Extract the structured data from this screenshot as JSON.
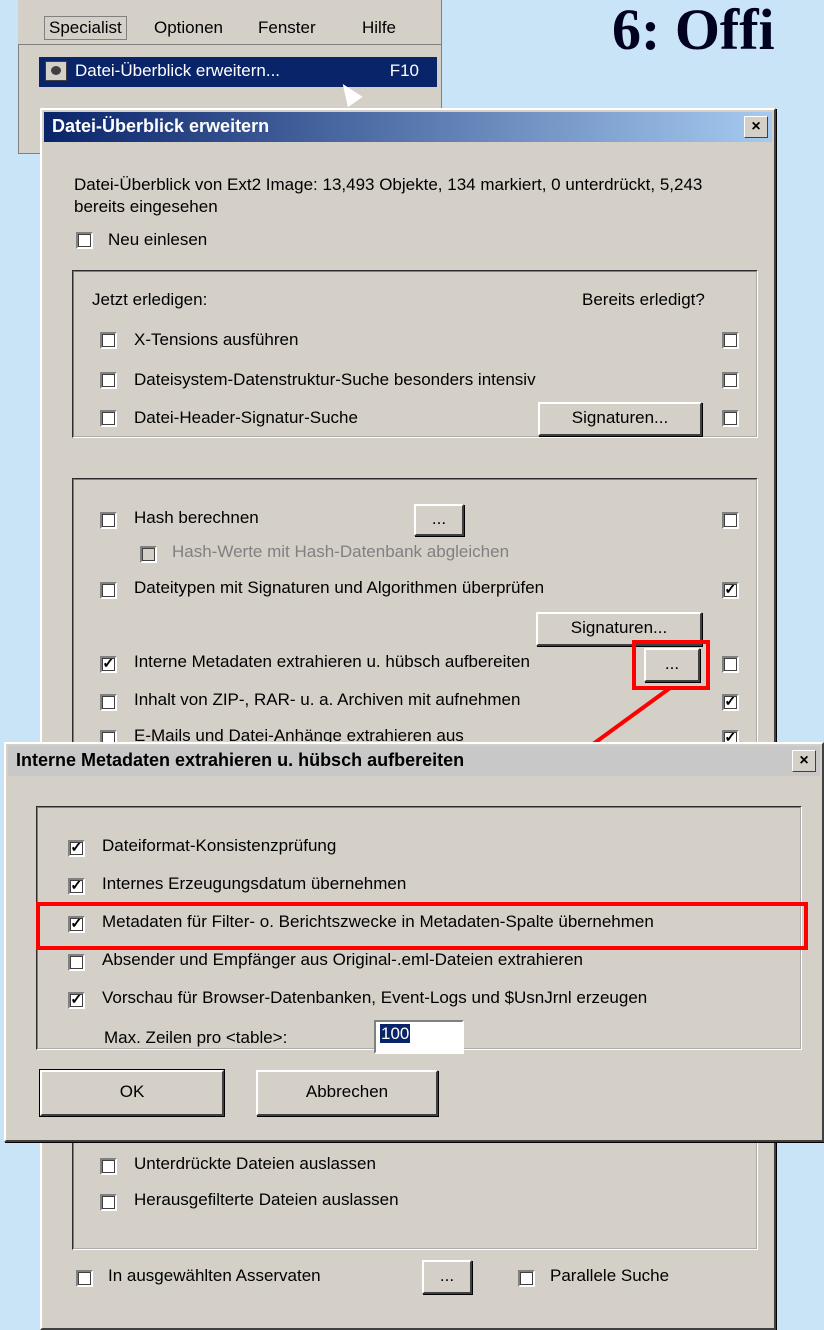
{
  "slide": {
    "title": "6: Offi"
  },
  "menu": {
    "items": [
      "Specialist",
      "Optionen",
      "Fenster",
      "Hilfe"
    ],
    "highlighted_item": "Datei-Überblick erweitern...",
    "highlighted_shortcut": "F10",
    "partial_item": "Parallele Suche",
    "partial_shortcut": "F10"
  },
  "main_dialog": {
    "title": "Datei-Überblick erweitern",
    "close": "×",
    "summary": "Datei-Überblick von Ext2 Image: 13,493 Objekte, 134 markiert, 0 unterdrückt, 5,243 bereits eingesehen",
    "reread": {
      "label": "Neu einlesen",
      "checked": false
    },
    "group1": {
      "header_left": "Jetzt erledigen:",
      "header_right": "Bereits erledigt?",
      "items": [
        {
          "label": "X-Tensions ausführen",
          "checked": false,
          "done": false
        },
        {
          "label": "Dateisystem-Datenstruktur-Suche besonders intensiv",
          "checked": false,
          "done": false
        },
        {
          "label": "Datei-Header-Signatur-Suche",
          "checked": false,
          "done": false
        }
      ],
      "signatures_button": "Signaturen..."
    },
    "group2": {
      "hash": {
        "label": "Hash berechnen",
        "checked": false,
        "done": false,
        "button": "..."
      },
      "hash_db": {
        "label": "Hash-Werte mit Hash-Datenbank abgleichen",
        "checked": false
      },
      "filetypes": {
        "label": "Dateitypen mit Signaturen und Algorithmen überprüfen",
        "checked": false,
        "done": true
      },
      "signatures_button": "Signaturen...",
      "metadata": {
        "label": "Interne Metadaten extrahieren u. hübsch aufbereiten",
        "checked": true,
        "done": false,
        "button": "..."
      },
      "archives": {
        "label": "Inhalt von ZIP-, RAR- u. a. Archiven mit aufnehmen",
        "checked": false,
        "done": true
      },
      "email": {
        "label": "E-Mails und Datei-Anhänge extrahieren aus",
        "checked": false,
        "done": true
      }
    },
    "group3": {
      "suppressed": {
        "label": "Unterdrückte Dateien auslassen",
        "checked": false
      },
      "filtered": {
        "label": "Herausgefilterte Dateien auslassen",
        "checked": false
      }
    },
    "evidence": {
      "label": "In ausgewählten Asservaten",
      "checked": false,
      "button": "..."
    },
    "parallel": {
      "label": "Parallele Suche",
      "checked": false
    }
  },
  "sub_dialog": {
    "title": "Interne Metadaten extrahieren u. hübsch aufbereiten",
    "close": "×",
    "options": [
      {
        "label": "Dateiformat-Konsistenzprüfung",
        "checked": true
      },
      {
        "label": "Internes Erzeugungsdatum übernehmen",
        "checked": true
      },
      {
        "label": "Metadaten für Filter- o. Berichtszwecke in Metadaten-Spalte übernehmen",
        "checked": true
      },
      {
        "label": "Absender und Empfänger aus Original-.eml-Dateien extrahieren",
        "checked": false
      },
      {
        "label": "Vorschau für Browser-Datenbanken, Event-Logs und $UsnJrnl erzeugen",
        "checked": true
      }
    ],
    "max_rows_label": "Max. Zeilen pro <table>:",
    "max_rows_value": "100",
    "ok": "OK",
    "cancel": "Abbrechen"
  },
  "annotation": {
    "color": "#ff0000"
  }
}
